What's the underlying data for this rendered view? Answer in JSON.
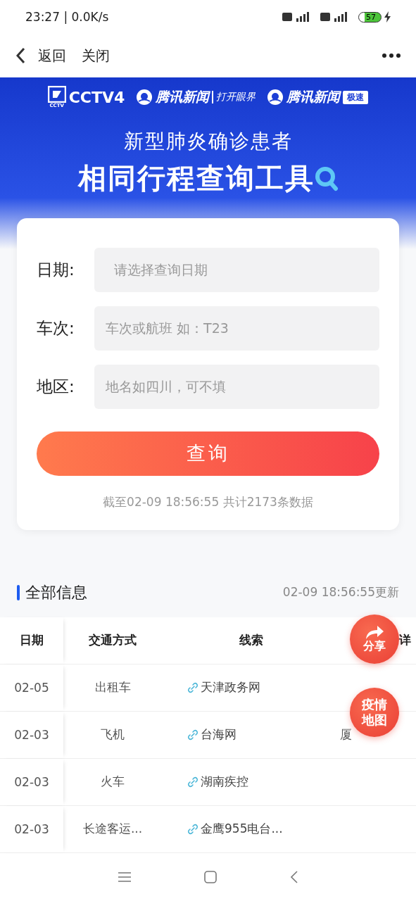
{
  "status_bar": {
    "time": "23:27 | 0.0K/s",
    "battery": "57"
  },
  "nav": {
    "back": "返回",
    "close": "关闭"
  },
  "banner": {
    "logos": [
      {
        "kind": "cctv",
        "text": "CCTV4",
        "sub": "CCTV"
      },
      {
        "kind": "tencent",
        "text": "腾讯新闻",
        "tag": "打开眼界"
      },
      {
        "kind": "tencent",
        "text": "腾讯新闻",
        "badge": "极速"
      }
    ],
    "subtitle": "新型肺炎确诊患者",
    "title": "相同行程查询工具"
  },
  "form": {
    "fields": [
      {
        "label": "日期:",
        "placeholder": "请选择查询日期"
      },
      {
        "label": "车次:",
        "placeholder": "车次或航班 如：T23"
      },
      {
        "label": "地区:",
        "placeholder": "地名如四川，可不填"
      }
    ],
    "button": "查询",
    "note": "截至02-09 18:56:55 共计2173条数据"
  },
  "section": {
    "title": "全部信息",
    "updated": "02-09 18:56:55更新"
  },
  "table": {
    "columns": [
      "日期",
      "交通方式",
      "线索",
      "详"
    ],
    "rows": [
      {
        "date": "02-05",
        "transport": "出租车",
        "clue": "天津政务网"
      },
      {
        "date": "02-03",
        "transport": "飞机",
        "clue": "台海网",
        "detail": "厦"
      },
      {
        "date": "02-03",
        "transport": "火车",
        "clue": "湖南疾控"
      },
      {
        "date": "02-03",
        "transport": "长途客运...",
        "clue": "金鹰955电台..."
      }
    ]
  },
  "floating_buttons": [
    "分享",
    "疫情地图"
  ]
}
